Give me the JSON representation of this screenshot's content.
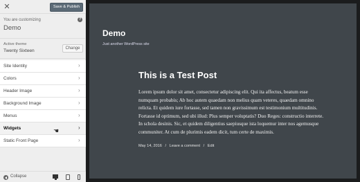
{
  "customizer": {
    "close_symbol": "✕",
    "save_label": "Save & Publish",
    "customizing_label": "You are customizing",
    "site_name": "Demo",
    "help_symbol": "?",
    "active_theme_label": "Active theme",
    "theme_name": "Twenty Sixteen",
    "change_label": "Change",
    "sections": [
      {
        "label": "Site Identity"
      },
      {
        "label": "Colors"
      },
      {
        "label": "Header Image"
      },
      {
        "label": "Background Image"
      },
      {
        "label": "Menus"
      },
      {
        "label": "Widgets"
      },
      {
        "label": "Static Front Page"
      }
    ],
    "active_section": "Widgets",
    "chevron": "›",
    "collapse_label": "Collapse"
  },
  "preview": {
    "blog_title": "Demo",
    "tagline": "Just another WordPress site",
    "post_title": "This is a Test Post",
    "post_body": "Lorem ipsum dolor sit amet, consectetur adipiscing elit. Qui ita affectus, beatum esse numquam probabis; Ab hoc autem quaedam non melius quam veteres, quaedam omnino relicta. Et quidem iure fortasse, sed tamen non gravissimum est testimonium multitudinis. Fortasse id optimum, sed ubi illud: Plus semper voluptatis? Duo Reges: constructio interrete. In schola desinis. Sic, et quidem diligentius saepiusque ista loquemur inter nos agemusque communiter. At cum de plurimis eadem dicit, tum certe de maximis.",
    "date": "May 14, 2016",
    "separator": "/",
    "comment_link": "Leave a comment",
    "edit_link": "Edit"
  },
  "colors": {
    "preview_bg": "#40464b",
    "save_button": "#5b6a76",
    "sidebar_bg": "#eeeeee"
  }
}
